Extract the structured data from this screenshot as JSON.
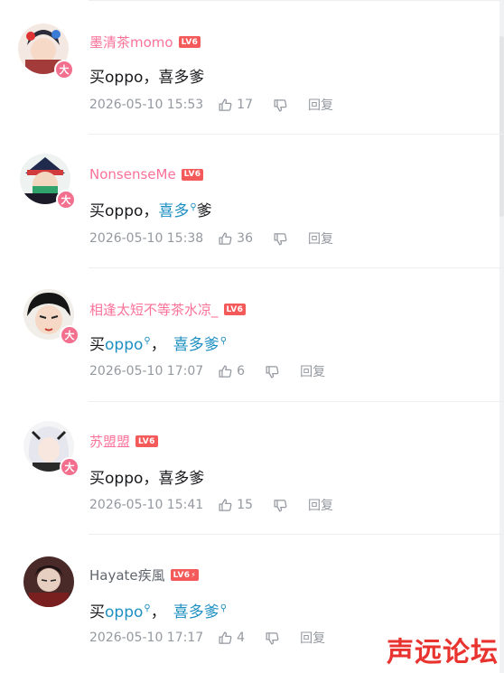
{
  "comments": [
    {
      "avatar": "avatar-anime-girl-ornate",
      "badge": "大",
      "username": "墨清茶momo",
      "username_style": "vip",
      "level": "LV6",
      "level_extra": "",
      "content": [
        "买oppo，喜多爹"
      ],
      "time": "2026-05-10 15:53",
      "likes": "17",
      "reply_label": "回复"
    },
    {
      "avatar": "avatar-anime-hat-green",
      "badge": "大",
      "username": "NonsenseMe",
      "username_style": "vip",
      "level": "LV6",
      "level_extra": "",
      "content_prefix": "买oppo，",
      "content_link": "喜多",
      "content_suffix": "爹",
      "time": "2026-05-10 15:38",
      "likes": "36",
      "reply_label": "回复"
    },
    {
      "avatar": "avatar-anime-girl-dark",
      "badge": "大",
      "username": "相逢太短不等茶水凉_",
      "username_style": "vip",
      "level": "LV6",
      "level_extra": "",
      "content_prefix": "买",
      "content_link1": "oppo",
      "content_mid": "，",
      "content_link2": "喜多爹",
      "time": "2026-05-10 17:07",
      "likes": "6",
      "reply_label": "回复"
    },
    {
      "avatar": "avatar-anime-white-hair",
      "badge": "大",
      "username": "苏盟盟",
      "username_style": "vip",
      "level": "LV6",
      "level_extra": "",
      "content": [
        "买oppo，喜多爹"
      ],
      "time": "2026-05-10 15:41",
      "likes": "15",
      "reply_label": "回复"
    },
    {
      "avatar": "avatar-anime-red-dark",
      "badge": "",
      "username": "Hayate疾風",
      "username_style": "plain",
      "level": "LV6",
      "level_extra": "⚡",
      "content_prefix": "买",
      "content_link1": "oppo",
      "content_mid": "，",
      "content_link2": "喜多爹",
      "time": "2026-05-10 17:17",
      "likes": "4",
      "reply_label": "回复"
    }
  ],
  "watermark": "声远论坛",
  "colors": {
    "vip_name": "#fb7299",
    "link": "#1e8fc2",
    "meta": "#9499a0",
    "level_bg": "#f45a5a",
    "badge_bg": "#f26f8e"
  }
}
